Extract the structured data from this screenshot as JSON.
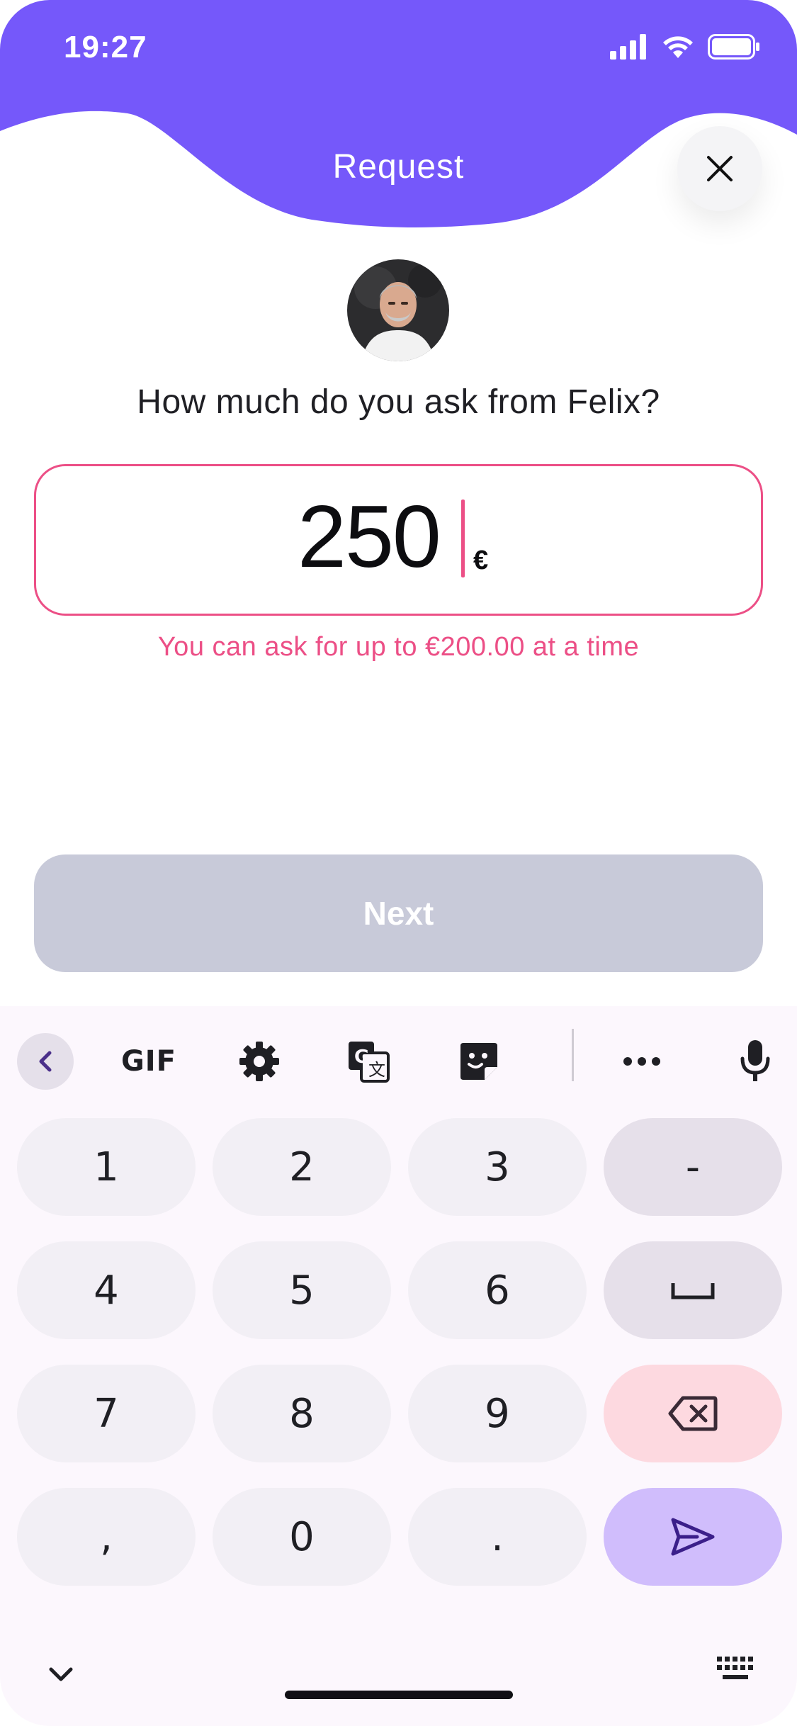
{
  "status_bar": {
    "time": "19:27"
  },
  "header": {
    "title": "Request"
  },
  "recipient": {
    "name": "Felix"
  },
  "question": "How much do you ask from Felix?",
  "amount": {
    "value": "250",
    "currency_symbol": "€"
  },
  "validation_message": "You can ask for up to €200.00 at a time",
  "next_button": {
    "label": "Next",
    "enabled": false
  },
  "keyboard": {
    "toolbar": {
      "gif_label": "GIF"
    },
    "keys": {
      "k1": "1",
      "k2": "2",
      "k3": "3",
      "minus": "-",
      "k4": "4",
      "k5": "5",
      "k6": "6",
      "k7": "7",
      "k8": "8",
      "k9": "9",
      "comma": ",",
      "k0": "0",
      "period": "."
    }
  },
  "colors": {
    "brand_purple": "#7558fa",
    "error_pink": "#ec4f86",
    "disabled_button": "#c8cad9",
    "keyboard_bg": "#fcf7fd",
    "enter_key": "#d0bdfc",
    "delete_key": "#fdd9e0"
  }
}
